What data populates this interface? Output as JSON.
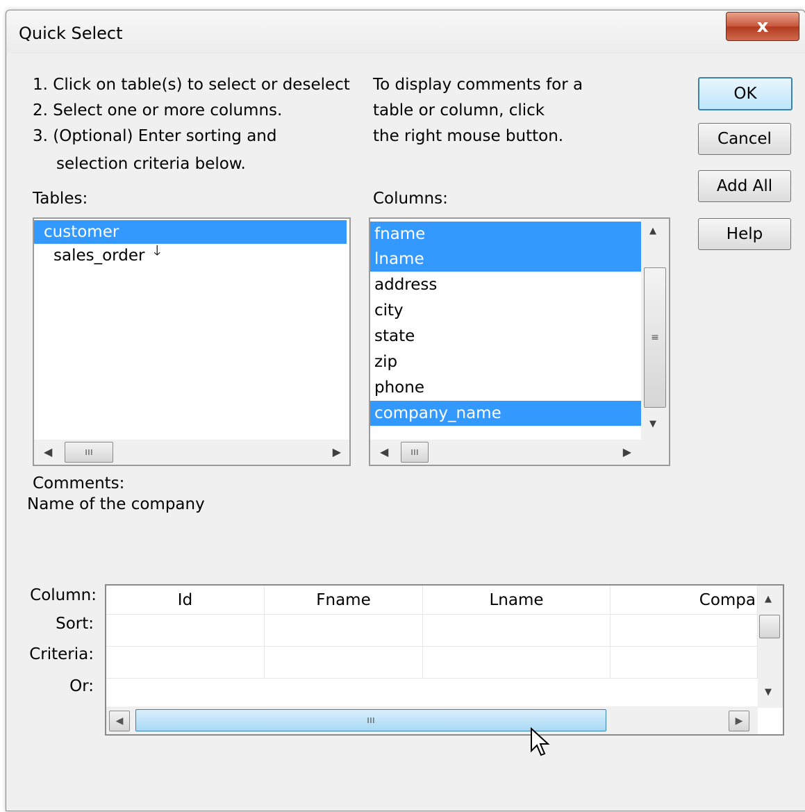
{
  "window": {
    "title": "Quick Select",
    "close_label": "x"
  },
  "instructions": {
    "step1": "1. Click on table(s) to select or deselect",
    "step2": "2. Select one or more columns.",
    "step3": "3. (Optional) Enter sorting and",
    "step3b": "selection criteria below.",
    "comments_line1": "To display comments for a",
    "comments_line2": "table or column, click",
    "comments_line3": "the right mouse button."
  },
  "buttons": {
    "ok": "OK",
    "cancel": "Cancel",
    "add_all": "Add All",
    "help": "Help"
  },
  "tables": {
    "label": "Tables:",
    "items": [
      {
        "label": "customer",
        "selected": true
      },
      {
        "label": "sales_order",
        "selected": false
      }
    ],
    "relation_icon": "down-arrow-icon"
  },
  "columns": {
    "label": "Columns:",
    "items": [
      {
        "label": "fname",
        "selected": true
      },
      {
        "label": "lname",
        "selected": true
      },
      {
        "label": "address",
        "selected": false
      },
      {
        "label": "city",
        "selected": false
      },
      {
        "label": "state",
        "selected": false
      },
      {
        "label": "zip",
        "selected": false
      },
      {
        "label": "phone",
        "selected": false
      },
      {
        "label": "company_name",
        "selected": true
      }
    ]
  },
  "comments": {
    "label": "Comments:",
    "text": "Name of the company"
  },
  "criteria_grid": {
    "row_labels": [
      "Column:",
      "Sort:",
      "Criteria:",
      "Or:"
    ],
    "columns": [
      "Id",
      "Fname",
      "Lname",
      "Compa"
    ]
  },
  "colors": {
    "selection": "#3399ff",
    "default_button_border": "#3c7fb1",
    "close_button": "#c7563b"
  }
}
